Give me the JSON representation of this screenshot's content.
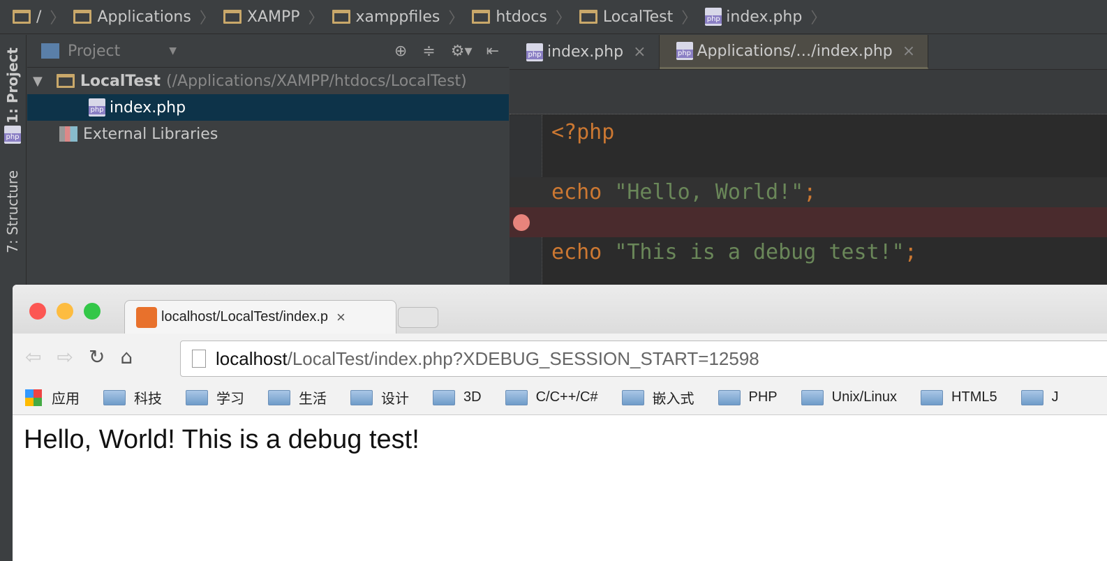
{
  "breadcrumb": [
    "/",
    "Applications",
    "XAMPP",
    "xamppfiles",
    "htdocs",
    "LocalTest",
    "index.php"
  ],
  "toolstrip": {
    "project": "1: Project",
    "structure": "7: Structure"
  },
  "project_panel": {
    "title": "Project",
    "root": "LocalTest",
    "root_path": "(/Applications/XAMPP/htdocs/LocalTest)",
    "file": "index.php",
    "external": "External Libraries"
  },
  "editor": {
    "tabs": [
      {
        "label": "index.php",
        "close": "×"
      },
      {
        "label": "Applications/…/index.php",
        "close": "×"
      }
    ],
    "lines": [
      {
        "kw": "<?php",
        "str": "",
        "end": ""
      },
      {
        "kw": "",
        "str": "",
        "end": ""
      },
      {
        "kw": "echo ",
        "str": "\"Hello, World!\"",
        "end": ";"
      },
      {
        "kw": "",
        "str": "",
        "end": ""
      },
      {
        "kw": "echo ",
        "str": "\"This is a debug test!\"",
        "end": ";"
      }
    ],
    "breakpoint_color": "#e8847c"
  },
  "browser": {
    "tab_title": "localhost/LocalTest/index.p",
    "tab_close": "×",
    "url_host": "localhost",
    "url_rest": "/LocalTest/index.php?XDEBUG_SESSION_START=12598",
    "bookmarks": [
      "应用",
      "科技",
      "学习",
      "生活",
      "设计",
      "3D",
      "C/C++/C#",
      "嵌入式",
      "PHP",
      "Unix/Linux",
      "HTML5",
      "J"
    ],
    "content": "Hello, World! This is a debug test!"
  }
}
